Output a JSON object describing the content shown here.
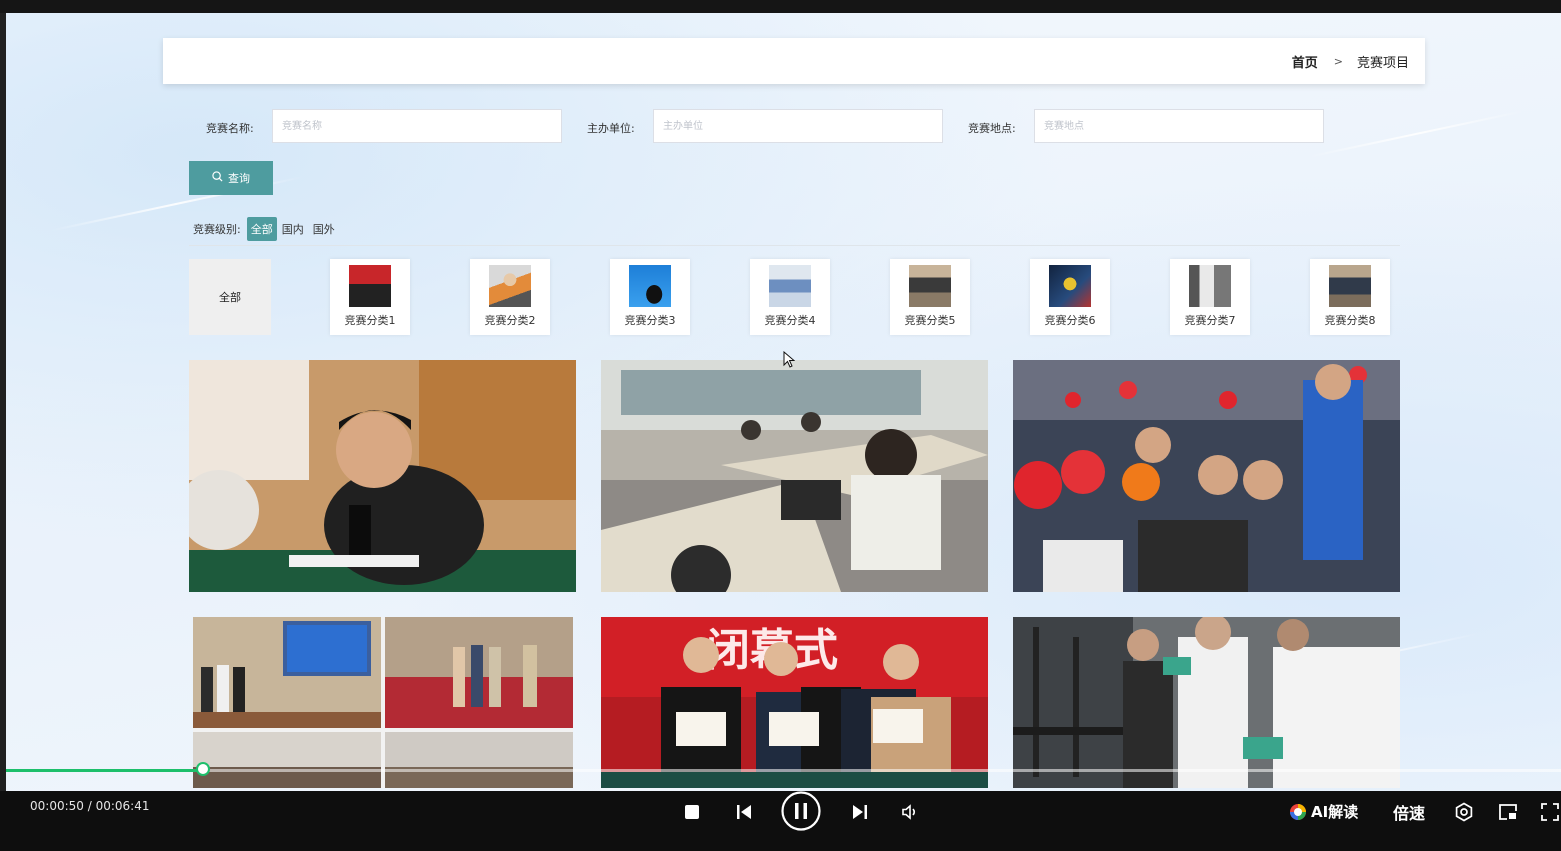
{
  "breadcrumb": {
    "home": "首页",
    "separator": ">",
    "current": "竞赛项目"
  },
  "filters": {
    "name_label": "竞赛名称:",
    "name_placeholder": "竞赛名称",
    "name_value": "",
    "organizer_label": "主办单位:",
    "organizer_placeholder": "主办单位",
    "organizer_value": "",
    "location_label": "竞赛地点:",
    "location_placeholder": "竞赛地点",
    "location_value": ""
  },
  "query_button": {
    "label": "查询",
    "icon": "search-icon"
  },
  "level_filter": {
    "label": "竞赛级别:",
    "options": [
      "全部",
      "国内",
      "国外"
    ],
    "selected": "全部"
  },
  "categories": {
    "all_label": "全部",
    "items": [
      {
        "label": "竞赛分类1"
      },
      {
        "label": "竞赛分类2"
      },
      {
        "label": "竞赛分类3"
      },
      {
        "label": "竞赛分类4"
      },
      {
        "label": "竞赛分类5"
      },
      {
        "label": "竞赛分类6"
      },
      {
        "label": "竞赛分类7"
      },
      {
        "label": "竞赛分类8"
      }
    ]
  },
  "photo_overlay_text": "闭幕式",
  "player": {
    "time": "00:00:50 / 00:06:41",
    "progress": 0.125,
    "ai_label": "AI解读",
    "speed_label": "倍速",
    "controls": [
      "stop-icon",
      "previous-icon",
      "pause-icon",
      "next-icon",
      "volume-icon",
      "settings-icon",
      "picture-in-picture-icon",
      "fullscreen-icon"
    ]
  },
  "colors": {
    "accent": "#4e9c9f",
    "progress": "#1dbf6b",
    "player_bg": "#0e0e0e"
  }
}
